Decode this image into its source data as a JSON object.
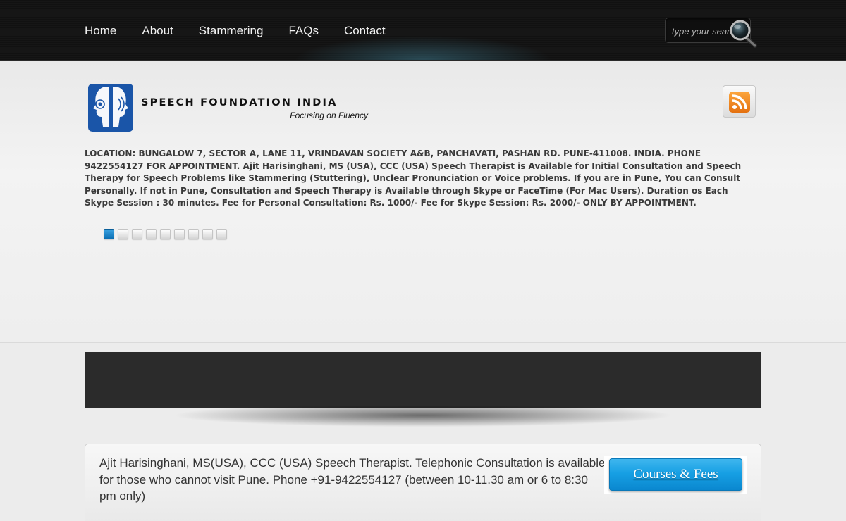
{
  "nav": {
    "items": [
      {
        "label": "Home"
      },
      {
        "label": "About"
      },
      {
        "label": "Stammering"
      },
      {
        "label": "FAQs"
      },
      {
        "label": "Contact"
      }
    ]
  },
  "search": {
    "placeholder": "type your search"
  },
  "brand": {
    "title": "SPEECH FOUNDATION INDIA",
    "tagline": "Focusing on Fluency",
    "logo_icon": "speech-faces-logo-icon",
    "feed_icon": "rss-icon"
  },
  "location_text": "LOCATION: BUNGALOW 7, SECTOR A, LANE 11, VRINDAVAN SOCIETY A&B, PANCHAVATI, PASHAN RD. PUNE-411008. INDIA. PHONE 9422554127 FOR APPOINTMENT. Ajit Harisinghani, MS (USA), CCC (USA) Speech Therapist is Available for Initial Consultation and Speech Therapy for Speech Problems like Stammering (Stuttering), Unclear Pronunciation or Voice problems. If you are in Pune, You can Consult Personally. If not in Pune, Consultation and Speech Therapy is Available through Skype or FaceTime (For Mac Users). Duration os Each Skype Session : 30 minutes. Fee for Personal Consultation: Rs. 1000/- Fee for Skype Session: Rs. 2000/- ONLY BY APPOINTMENT.",
  "slider": {
    "count": 9,
    "active_index": 0
  },
  "info": {
    "text": "Ajit Harisinghani, MS(USA), CCC (USA) Speech Therapist. Telephonic Consultation is available for those who cannot visit Pune. Phone +91-9422554127 (between 10-11.30 am or 6 to 8:30 pm only)",
    "button_label": "Courses & Fees"
  },
  "colors": {
    "topbar": "#121212",
    "accent_blue": "#17a0e4",
    "logo_blue": "#1a55a8",
    "rss_orange": "#f38a1e"
  }
}
